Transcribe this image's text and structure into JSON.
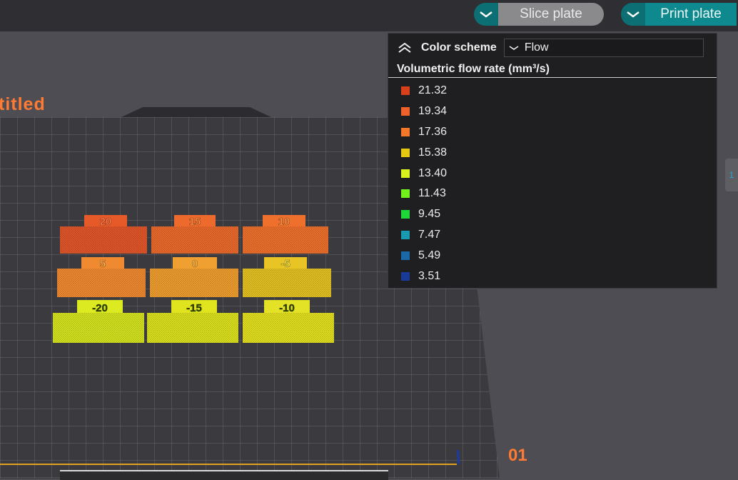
{
  "toolbar": {
    "slice_label": "Slice plate",
    "print_label": "Print plate"
  },
  "plate": {
    "title_fragment": "titled",
    "number": "01"
  },
  "legend": {
    "header_label": "Color scheme",
    "scheme_value": "Flow",
    "subtitle": "Volumetric flow rate (mm³/s)",
    "items": [
      {
        "value": "21.32",
        "color": "#d8401c"
      },
      {
        "value": "19.34",
        "color": "#f0602a"
      },
      {
        "value": "17.36",
        "color": "#f5782a"
      },
      {
        "value": "15.38",
        "color": "#e5c812"
      },
      {
        "value": "13.40",
        "color": "#d8f01c"
      },
      {
        "value": "11.43",
        "color": "#72f01e"
      },
      {
        "value": "9.45",
        "color": "#1ed83a"
      },
      {
        "value": "7.47",
        "color": "#1a9ab0"
      },
      {
        "value": "5.49",
        "color": "#1a68a8"
      },
      {
        "value": "3.51",
        "color": "#1a3a98"
      }
    ]
  },
  "sample_labels": [
    "20",
    "15",
    "10",
    "5",
    "0",
    "-5",
    "-20",
    "-15",
    "-10"
  ],
  "side_tab_text": "1"
}
